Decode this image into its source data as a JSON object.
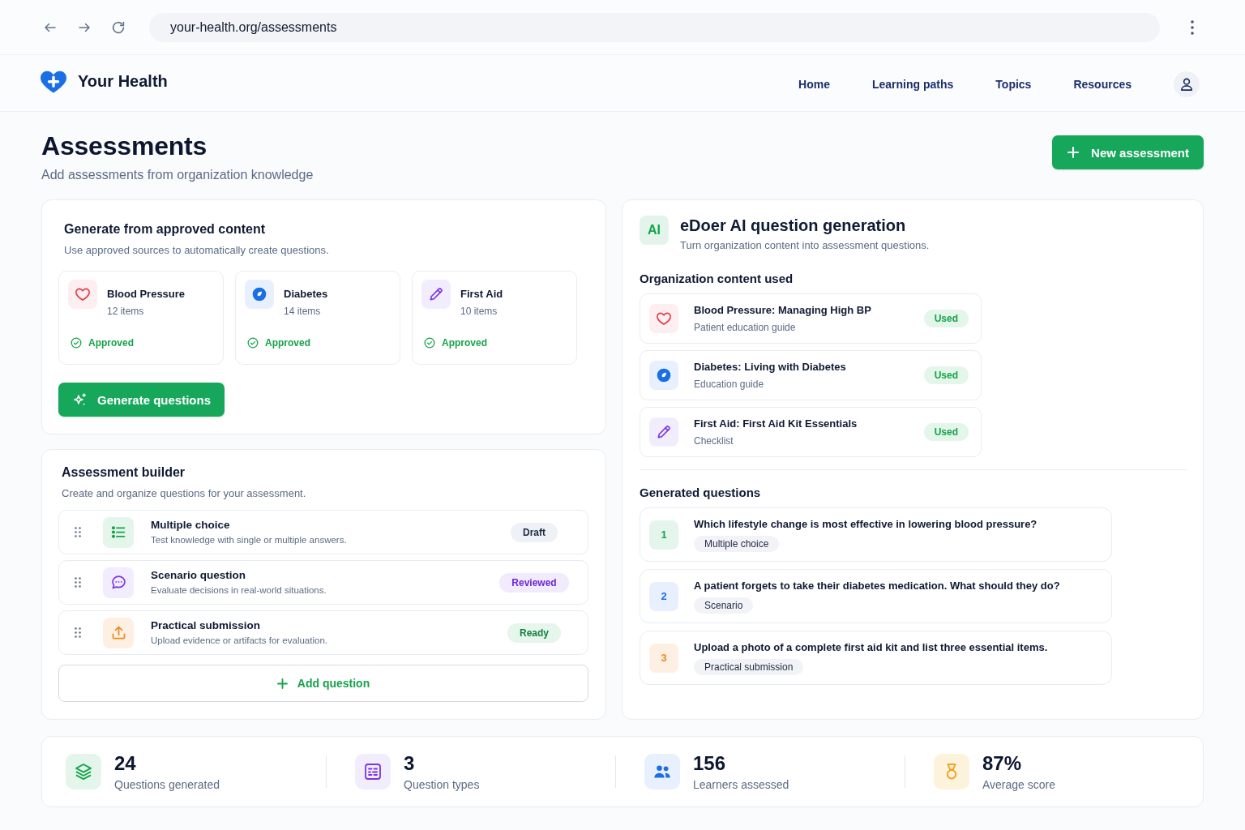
{
  "browser": {
    "url": "your-health.org/assessments"
  },
  "header": {
    "brand": "Your Health",
    "nav": [
      "Home",
      "Learning paths",
      "Topics",
      "Resources"
    ]
  },
  "page": {
    "title": "Assessments",
    "subtitle": "Add assessments from organization knowledge",
    "primary_action": "New assessment"
  },
  "generate_panel": {
    "title": "Generate from approved content",
    "description": "Use approved sources to automatically create questions.",
    "sources": [
      {
        "kind": "cardio",
        "name": "Blood Pressure",
        "count": "12 items",
        "status": "Approved",
        "approved": true
      },
      {
        "kind": "diabetes",
        "name": "Diabetes",
        "count": "14 items",
        "status": "Approved",
        "approved": true
      },
      {
        "kind": "firstaid",
        "name": "First Aid",
        "count": "10 items",
        "status": "Approved",
        "approved": true
      }
    ],
    "button": "Generate questions"
  },
  "builder": {
    "title": "Assessment builder",
    "description": "Create and organize questions for your assessment.",
    "rows": [
      {
        "kind": "multiple",
        "title": "Multiple choice",
        "description": "Test knowledge with single or multiple answers.",
        "badge": {
          "kind": "draft",
          "label": "Draft"
        }
      },
      {
        "kind": "scenario",
        "title": "Scenario question",
        "description": "Evaluate decisions in real-world situations.",
        "badge": {
          "kind": "reviewed",
          "label": "Reviewed"
        }
      },
      {
        "kind": "practical",
        "title": "Practical submission",
        "description": "Upload evidence or artifacts for evaluation.",
        "badge": {
          "kind": "ready",
          "label": "Ready"
        }
      }
    ],
    "add_button": "Add question"
  },
  "ai_panel": {
    "badge": "AI",
    "title": "eDoer AI question generation",
    "subtitle": "Turn organization content into assessment questions.",
    "content_heading": "Organization content used",
    "content": [
      {
        "kind": "cardio",
        "title": "Blood Pressure: Managing High BP",
        "type": "Patient education guide",
        "badge": "Used"
      },
      {
        "kind": "diabetes",
        "title": "Diabetes: Living with Diabetes",
        "type": "Education guide",
        "badge": "Used"
      },
      {
        "kind": "firstaid",
        "title": "First Aid: First Aid Kit Essentials",
        "type": "Checklist",
        "badge": "Used"
      }
    ],
    "questions_heading": "Generated questions",
    "questions": [
      {
        "kind": "multiple",
        "number": "1",
        "text": "Which lifestyle change is most effective in lowering blood pressure?",
        "tag": "Multiple choice"
      },
      {
        "kind": "scenario",
        "number": "2",
        "text": "A patient forgets to take their diabetes medication. What should they do?",
        "tag": "Scenario"
      },
      {
        "kind": "practical",
        "number": "3",
        "text": "Upload a photo of a complete first aid kit and list three essential items.",
        "tag": "Practical submission"
      }
    ]
  },
  "stats": [
    {
      "kind": "questions",
      "value": "24",
      "label": "Questions generated"
    },
    {
      "kind": "types",
      "value": "3",
      "label": "Question types"
    },
    {
      "kind": "learners",
      "value": "156",
      "label": "Learners assessed"
    },
    {
      "kind": "score",
      "value": "87%",
      "label": "Average score"
    }
  ]
}
